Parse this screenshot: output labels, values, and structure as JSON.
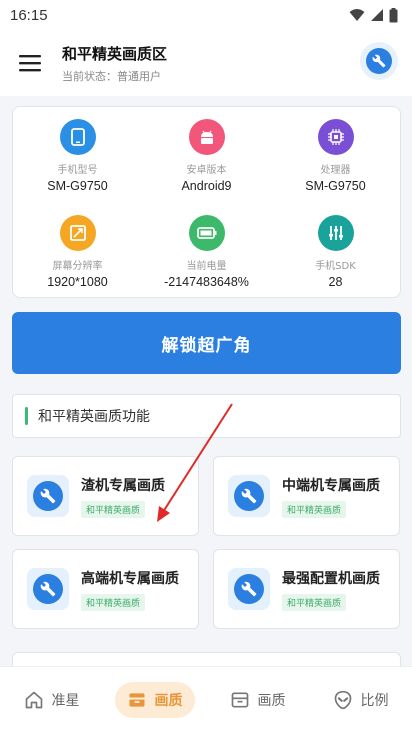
{
  "status_bar": {
    "time": "16:15"
  },
  "header": {
    "title": "和平精英画质区",
    "subtitle": "当前状态：普通用户"
  },
  "device_info": [
    {
      "label": "手机型号",
      "value": "SM-G9750",
      "icon": "phone-icon",
      "color": "#2a8fe5"
    },
    {
      "label": "安卓版本",
      "value": "Android9",
      "icon": "android-icon",
      "color": "#f2567a"
    },
    {
      "label": "处理器",
      "value": "SM-G9750",
      "icon": "chip-icon",
      "color": "#7a4fd6"
    },
    {
      "label": "屏幕分辨率",
      "value": "1920*1080",
      "icon": "resolution-icon",
      "color": "#f5a623"
    },
    {
      "label": "当前电量",
      "value": "-2147483648%",
      "icon": "battery-icon",
      "color": "#3cb96a"
    },
    {
      "label": "手机SDK",
      "value": "28",
      "icon": "sliders-icon",
      "color": "#1aa39a"
    }
  ],
  "unlock_button": {
    "label": "解锁超广角"
  },
  "section": {
    "title": "和平精英画质功能"
  },
  "features": [
    {
      "title": "渣机专属画质",
      "tag": "和平精英画质"
    },
    {
      "title": "中端机专属画质",
      "tag": "和平精英画质"
    },
    {
      "title": "高端机专属画质",
      "tag": "和平精英画质"
    },
    {
      "title": "最强配置机画质",
      "tag": "和平精英画质"
    }
  ],
  "bottom_nav": [
    {
      "label": "准星",
      "icon": "home-icon",
      "active": false
    },
    {
      "label": "画质",
      "icon": "quality-icon",
      "active": true
    },
    {
      "label": "画质",
      "icon": "box-icon",
      "active": false
    },
    {
      "label": "比例",
      "icon": "alien-icon",
      "active": false
    }
  ],
  "colors": {
    "primary": "#2b7fe0",
    "active_nav": "#e8963a",
    "tag_green": "#3caa6a"
  }
}
